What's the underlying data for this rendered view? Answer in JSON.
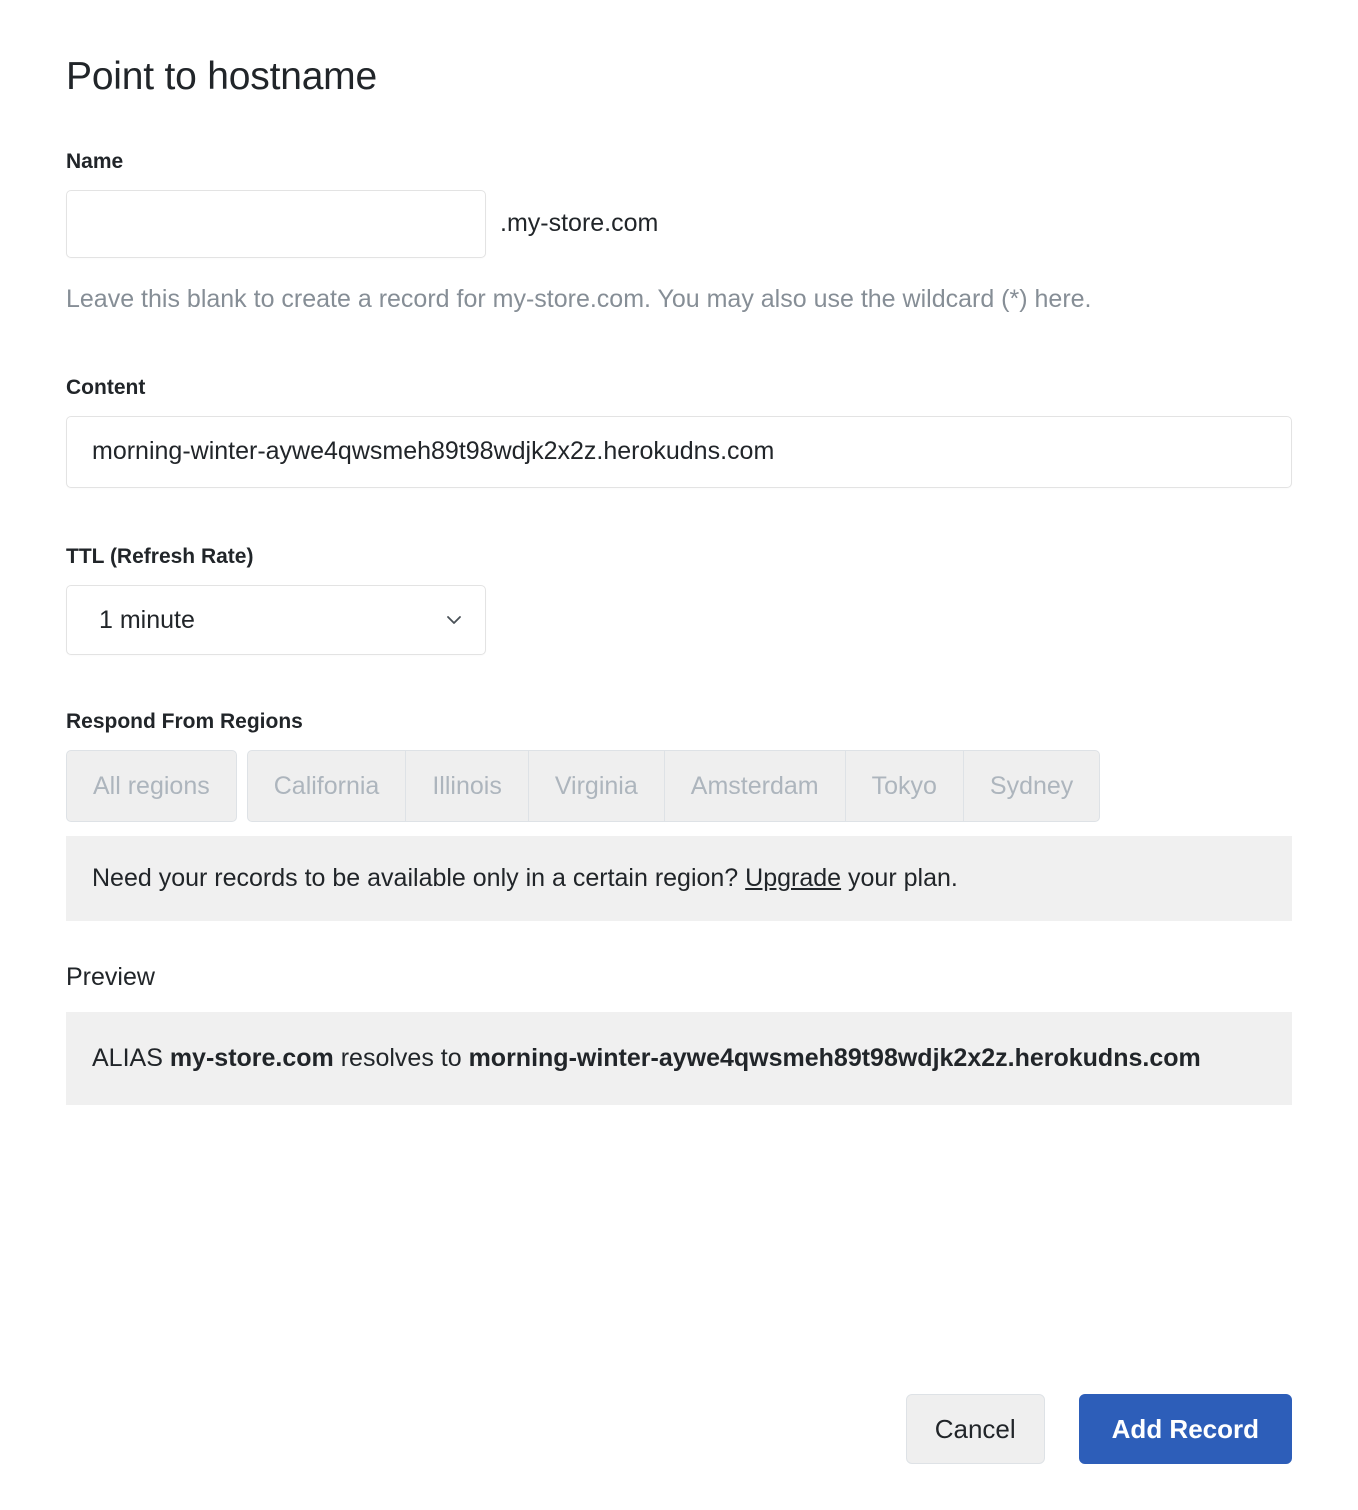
{
  "dialog": {
    "title": "Point to hostname"
  },
  "name_field": {
    "label": "Name",
    "value": "",
    "placeholder": "",
    "domain_suffix": ".my-store.com",
    "help_text": "Leave this blank to create a record for my-store.com. You may also use the wildcard (*) here."
  },
  "content_field": {
    "label": "Content",
    "value": "morning-winter-aywe4qwsmeh89t98wdjk2x2z.herokudns.com",
    "placeholder": ""
  },
  "ttl_field": {
    "label": "TTL (Refresh Rate)",
    "selected": "1 minute",
    "options": [
      "1 minute"
    ],
    "chevron_icon": "chevron-down-icon"
  },
  "regions": {
    "label": "Respond From Regions",
    "all_regions_label": "All regions",
    "items": [
      "California",
      "Illinois",
      "Virginia",
      "Amsterdam",
      "Tokyo",
      "Sydney"
    ]
  },
  "notice": {
    "text_before": "Need your records to be available only in a certain region?",
    "link_label": "Upgrade",
    "text_after": "your plan."
  },
  "preview": {
    "label": "Preview",
    "record_type": "ALIAS",
    "hostname": "my-store.com",
    "connector": "resolves to",
    "target": "morning-winter-aywe4qwsmeh89t98wdjk2x2z.herokudns.com"
  },
  "actions": {
    "cancel_label": "Cancel",
    "submit_label": "Add Record"
  },
  "colors": {
    "primary": "#2d5eb9",
    "panel_bg": "#f0f0f0",
    "muted_text": "#868e96",
    "disabled_text": "#adb5bd",
    "border": "#e3e3e3"
  }
}
